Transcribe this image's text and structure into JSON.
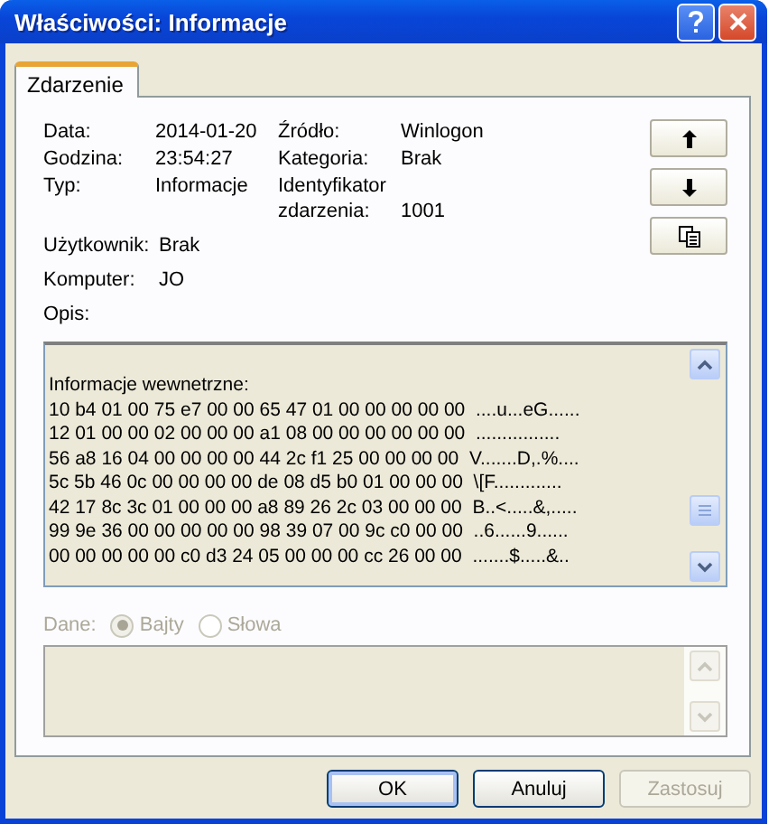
{
  "window": {
    "title": "Właściwości: Informacje"
  },
  "tabs": [
    {
      "label": "Zdarzenie",
      "selected": true
    }
  ],
  "fields": [
    {
      "label": "Data:",
      "value": "2014-01-20"
    },
    {
      "label": "Źródło:",
      "value": "Winlogon"
    },
    {
      "label": "Godzina:",
      "value": "23:54:27"
    },
    {
      "label": "Kategoria:",
      "value": "Brak"
    },
    {
      "label": "Typ:",
      "value": "Informacje"
    },
    {
      "label": "Identyfikator zdarzenia:",
      "value": "1001"
    }
  ],
  "user": {
    "label": "Użytkownik:",
    "value": "Brak"
  },
  "computer": {
    "label": "Komputer:",
    "value": "JO"
  },
  "description": {
    "label": "Opis:",
    "lines": [
      "Informacje wewnetrzne:",
      "10 b4 01 00 75 e7 00 00 65 47 01 00 00 00 00 00  ....u...eG......",
      "12 01 00 00 02 00 00 00 a1 08 00 00 00 00 00 00  ................",
      "56 a8 16 04 00 00 00 00 44 2c f1 25 00 00 00 00  V.......D,.%....",
      "5c 5b 46 0c 00 00 00 00 de 08 d5 b0 01 00 00 00  \\[F.............",
      "42 17 8c 3c 01 00 00 00 a8 89 26 2c 03 00 00 00  B..<.....&,.....",
      "99 9e 36 00 00 00 00 00 98 39 07 00 9c c0 00 00  ..6......9......",
      "00 00 00 00 00 c0 d3 24 05 00 00 00 cc 26 00 00  .......$.....&.."
    ]
  },
  "data_section": {
    "label": "Dane:",
    "disabled": true,
    "options": [
      {
        "label": "Bajty",
        "selected": true
      },
      {
        "label": "Słowa",
        "selected": false
      }
    ]
  },
  "buttons": [
    {
      "label": "OK",
      "default": true,
      "disabled": false
    },
    {
      "label": "Anuluj",
      "default": false,
      "disabled": false
    },
    {
      "label": "Zastosuj",
      "default": false,
      "disabled": true
    }
  ]
}
